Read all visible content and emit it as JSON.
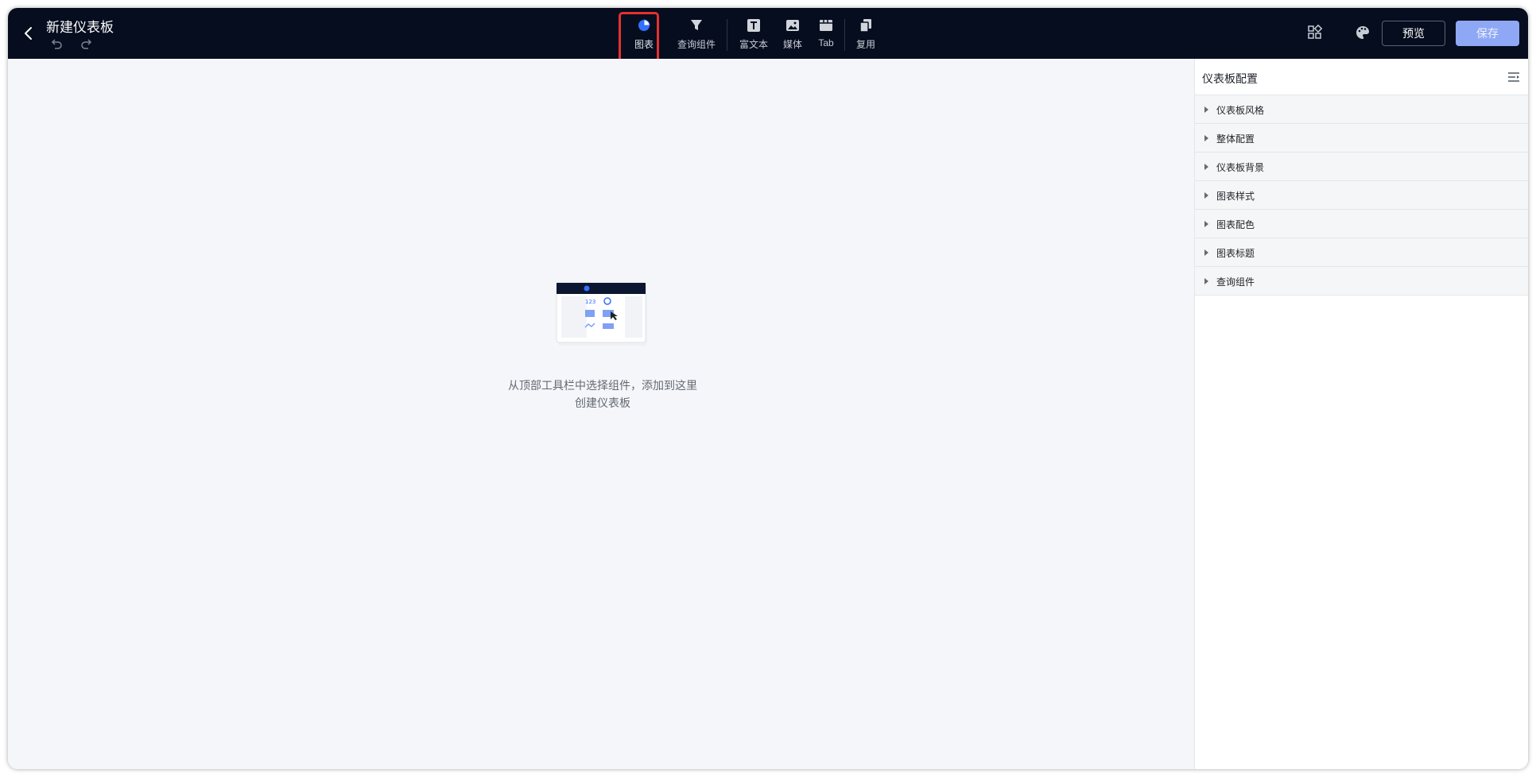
{
  "header": {
    "title": "新建仪表板",
    "toolbar": [
      {
        "label": "图表",
        "icon": "pie-chart-icon"
      },
      {
        "label": "查询组件",
        "icon": "filter-icon"
      },
      {
        "label": "富文本",
        "icon": "text-icon"
      },
      {
        "label": "媒体",
        "icon": "image-icon"
      },
      {
        "label": "Tab",
        "icon": "tab-icon"
      },
      {
        "label": "复用",
        "icon": "copy-icon"
      }
    ],
    "preview_label": "预览",
    "save_label": "保存"
  },
  "canvas": {
    "empty_line1": "从顶部工具栏中选择组件，添加到这里",
    "empty_line2": "创建仪表板"
  },
  "panel": {
    "title": "仪表板配置",
    "sections": [
      "仪表板风格",
      "整体配置",
      "仪表板背景",
      "图表样式",
      "图表配色",
      "图表标题",
      "查询组件"
    ]
  },
  "colors": {
    "topbar": "#050d1f",
    "accent": "#3370ff",
    "save_button": "#8fa8f5",
    "highlight": "#e5312f"
  }
}
